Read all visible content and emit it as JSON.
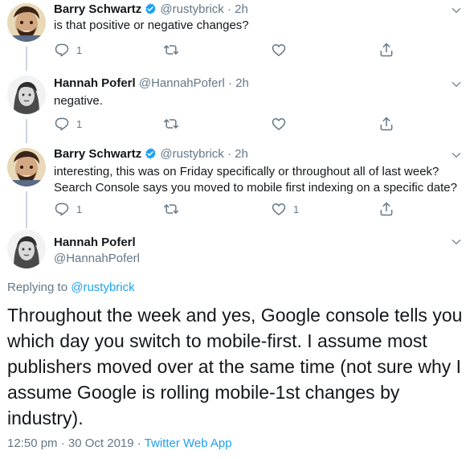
{
  "tweets": [
    {
      "name": "Barry Schwartz",
      "verified": true,
      "handle": "@rustybrick",
      "sep": "·",
      "time": "2h",
      "text": [
        "is that positive or negative changes?"
      ],
      "reply_count": "1",
      "like_count": ""
    },
    {
      "name": "Hannah Poferl",
      "verified": false,
      "handle": "@HannahPoferl",
      "sep": "·",
      "time": "2h",
      "text": [
        "negative."
      ],
      "reply_count": "1",
      "like_count": ""
    },
    {
      "name": "Barry Schwartz",
      "verified": true,
      "handle": "@rustybrick",
      "sep": "·",
      "time": "2h",
      "text": [
        "interesting, this was on Friday specifically or throughout all of last week?",
        "Search Console says you moved to mobile first indexing on a specific date?"
      ],
      "reply_count": "1",
      "like_count": "1"
    }
  ],
  "main_tweet": {
    "name": "Hannah Poferl",
    "handle": "@HannahPoferl",
    "replying_prefix": "Replying to ",
    "replying_to": "@rustybrick",
    "text": "Throughout the week and yes, Google console tells you which day you switch to mobile-first. I assume most publishers moved over at the same time (not sure why I assume Google is rolling mobile-1st changes by industry).",
    "timestamp": "12:50 pm · 30 Oct 2019",
    "sep": " · ",
    "source": "Twitter Web App"
  },
  "icons": {
    "reply": "reply-icon",
    "retweet": "retweet-icon",
    "like": "heart-icon",
    "share": "share-icon",
    "caret": "chevron-down-icon",
    "verified": "verified-badge-icon"
  },
  "colors": {
    "text": "#14171a",
    "muted": "#657786",
    "link": "#1da1f2",
    "thread_line": "#ccd6dd",
    "verified": "#1da1f2"
  }
}
